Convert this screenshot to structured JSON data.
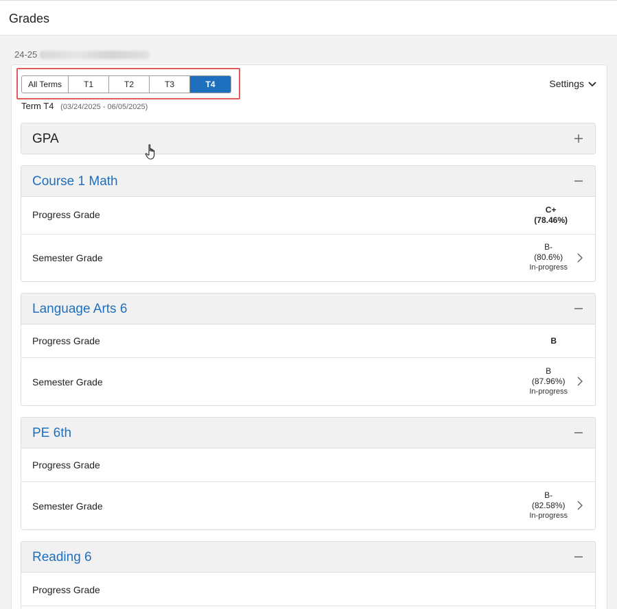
{
  "page": {
    "title": "Grades"
  },
  "year": {
    "label": "24-25"
  },
  "terms": {
    "tabs": [
      {
        "label": "All Terms",
        "active": false
      },
      {
        "label": "T1",
        "active": false
      },
      {
        "label": "T2",
        "active": false
      },
      {
        "label": "T3",
        "active": false
      },
      {
        "label": "T4",
        "active": true
      }
    ],
    "settings_label": "Settings",
    "current_term": "Term T4",
    "current_term_dates": "(03/24/2025 - 06/05/2025)"
  },
  "gpa": {
    "label": "GPA"
  },
  "courses": [
    {
      "name": "Course 1 Math",
      "progress_label": "Progress Grade",
      "progress_grade": "C+",
      "progress_percent": "(78.46%)",
      "semester_label": "Semester Grade",
      "semester_grade": "B-",
      "semester_percent": "(80.6%)",
      "semester_status": "In-progress"
    },
    {
      "name": "Language Arts 6",
      "progress_label": "Progress Grade",
      "progress_grade": "B",
      "progress_percent": "",
      "semester_label": "Semester Grade",
      "semester_grade": "B",
      "semester_percent": "(87.96%)",
      "semester_status": "In-progress"
    },
    {
      "name": "PE 6th",
      "progress_label": "Progress Grade",
      "progress_grade": "",
      "progress_percent": "",
      "semester_label": "Semester Grade",
      "semester_grade": "B-",
      "semester_percent": "(82.58%)",
      "semester_status": "In-progress"
    },
    {
      "name": "Reading 6",
      "progress_label": "Progress Grade"
    }
  ],
  "colors": {
    "accent": "#1f6fbf",
    "highlight": "#e05a5a"
  }
}
